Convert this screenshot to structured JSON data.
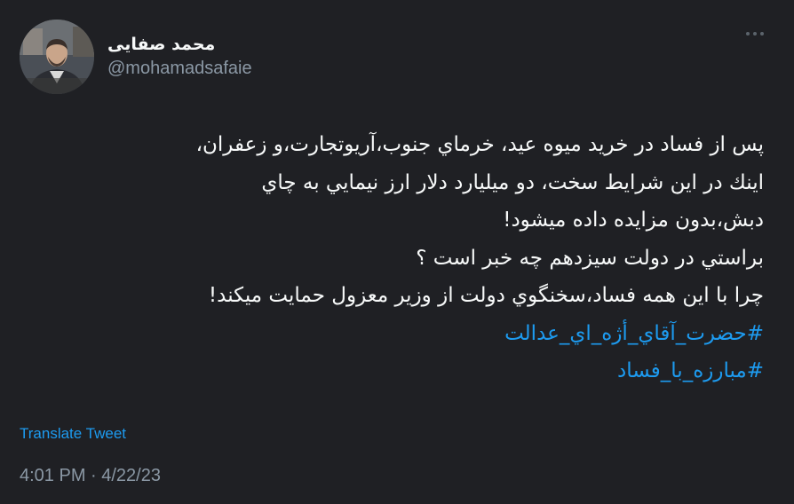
{
  "author": {
    "display_name": "محمد صفایی",
    "handle": "@mohamadsafaie"
  },
  "icons": {
    "avatar": "profile-photo",
    "more": "more-options-icon"
  },
  "tweet": {
    "lines": [
      "پس از فساد در خريد ميوه عيد، خرماي جنوب،آريوتجارت،و زعفران،",
      "اينك در اين شرايط سخت، دو ميليارد دلار ارز نيمايي به چاي",
      "دبش،بدون مزايده داده ميشود!",
      "براستي در دولت سيزدهم چه خبر است ؟",
      "چرا با اين همه فساد،سخنگوي دولت از وزير معزول حمايت ميكند!"
    ],
    "hashtags": [
      "#حضرت_آقاي_أژه_اي_عدالت",
      "#مبارزه_با_فساد"
    ]
  },
  "translate_label": "Translate Tweet",
  "timestamp": "4:01 PM · 4/22/23",
  "colors": {
    "background": "#1f2024",
    "text": "#f7f9f9",
    "secondary": "#8b98a5",
    "link": "#1d9bf0"
  }
}
